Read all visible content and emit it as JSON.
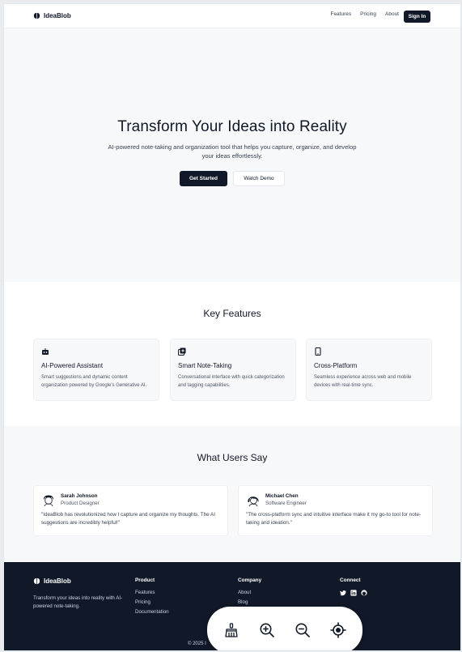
{
  "header": {
    "logo_text": "IdeaBlob",
    "nav": [
      "Features",
      "Pricing",
      "About"
    ],
    "signin_label": "Sign In"
  },
  "hero": {
    "title": "Transform Your Ideas into Reality",
    "subtitle": "AI-powered note-taking and organization tool that helps you capture, organize, and develop your ideas effortlessly.",
    "primary_label": "Get Started",
    "secondary_label": "Watch Demo"
  },
  "features": {
    "title": "Key Features",
    "items": [
      {
        "icon": "robot-icon",
        "title": "AI-Powered Assistant",
        "desc": "Smart suggestions and dynamic content organization powered by Google's Generative AI."
      },
      {
        "icon": "notes-plus-icon",
        "title": "Smart Note-Taking",
        "desc": "Conversational interface with quick categorization and tagging capabilities."
      },
      {
        "icon": "mobile-icon",
        "title": "Cross-Platform",
        "desc": "Seamless experience across web and mobile devices with real-time sync."
      }
    ]
  },
  "testimonials": {
    "title": "What Users Say",
    "items": [
      {
        "name": "Sarah Johnson",
        "role": "Product Designer",
        "quote": "\"IdeaBlob has revolutionized how I capture and organize my thoughts. The AI suggestions are incredibly helpful!\""
      },
      {
        "name": "Michael Chen",
        "role": "Software Engineer",
        "quote": "\"The cross-platform sync and intuitive interface make it my go-to tool for note-taking and ideation.\""
      }
    ]
  },
  "footer": {
    "logo_text": "IdeaBlob",
    "tagline": "Transform your ideas into reality with AI-powered note-taking.",
    "product": {
      "heading": "Product",
      "links": [
        "Features",
        "Pricing",
        "Documentation"
      ]
    },
    "company": {
      "heading": "Company",
      "links": [
        "About",
        "Blog"
      ]
    },
    "connect": {
      "heading": "Connect",
      "icons": [
        "twitter-icon",
        "linkedin-icon",
        "github-icon"
      ]
    },
    "copyright": "© 2025 I"
  },
  "toolbar": {
    "icons": [
      "broom-icon",
      "zoom-in-icon",
      "zoom-out-icon",
      "target-icon"
    ]
  },
  "colors": {
    "dark": "#111827",
    "page_bg": "#f7f8fa",
    "card_bg": "#ffffff"
  }
}
